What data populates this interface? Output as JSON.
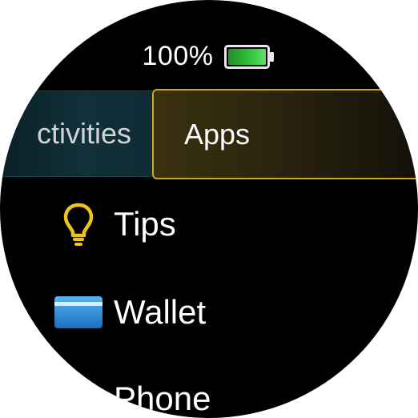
{
  "status": {
    "battery_text": "100%",
    "battery_icon": "battery-full-icon",
    "battery_color": "#2fbf3a"
  },
  "tabs": [
    {
      "label": "Activities",
      "visible_label": "ctivities",
      "selected": false
    },
    {
      "label": "Apps",
      "selected": true
    }
  ],
  "apps": [
    {
      "label": "Tips",
      "icon": "lightbulb-icon",
      "color": "#f0c419"
    },
    {
      "label": "Wallet",
      "icon": "wallet-card-icon",
      "color": "#2f8fd8"
    },
    {
      "label": "Phone",
      "icon": "phone-icon",
      "color": "#ffffff"
    }
  ],
  "colors": {
    "accent_selected": "#c9a825",
    "background": "#000000",
    "text": "#ffffff"
  }
}
